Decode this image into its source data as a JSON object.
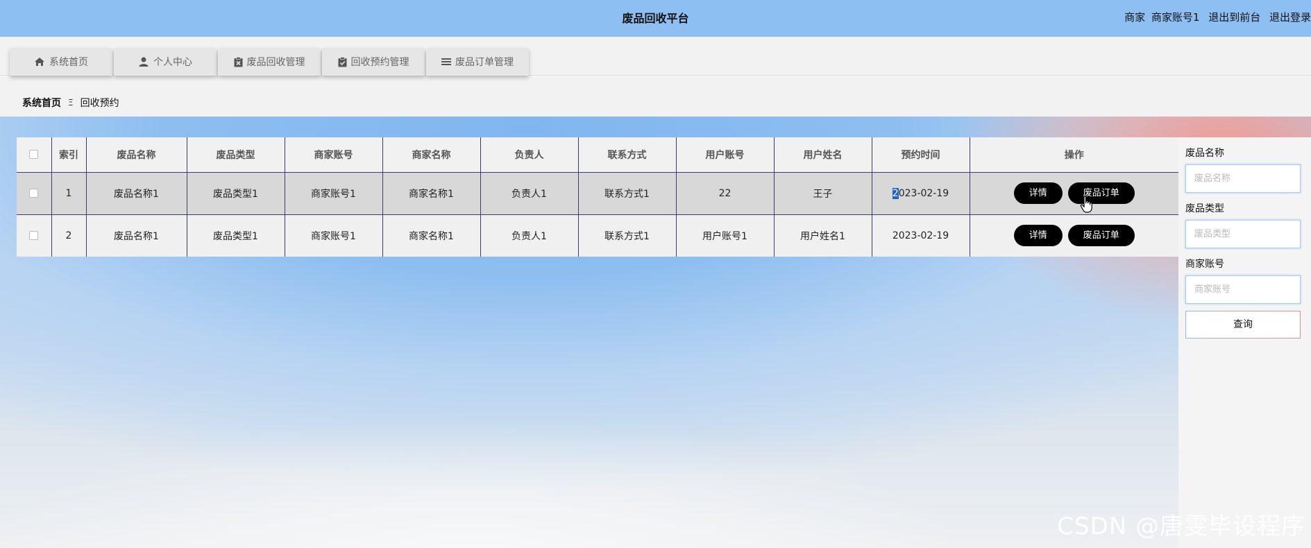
{
  "header": {
    "title": "废品回收平台",
    "user_role": "商家",
    "user_account": "商家账号1",
    "front_link": "退出到前台",
    "logout_link": "退出登录"
  },
  "nav": {
    "tabs": [
      {
        "label": "系统首页",
        "icon": "home-icon"
      },
      {
        "label": "个人中心",
        "icon": "person-icon"
      },
      {
        "label": "废品回收管理",
        "icon": "clipboard-x-icon"
      },
      {
        "label": "回收预约管理",
        "icon": "clipboard-check-icon"
      },
      {
        "label": "废品订单管理",
        "icon": "list-icon"
      }
    ]
  },
  "breadcrumb": {
    "home": "系统首页",
    "separator": "Ξ",
    "current": "回收预约"
  },
  "table": {
    "headers": [
      "索引",
      "废品名称",
      "废品类型",
      "商家账号",
      "商家名称",
      "负责人",
      "联系方式",
      "用户账号",
      "用户姓名",
      "预约时间",
      "操作"
    ],
    "rows": [
      {
        "index": "1",
        "name": "废品名称1",
        "type": "废品类型1",
        "merchant_account": "商家账号1",
        "merchant_name": "商家名称1",
        "person": "负责人1",
        "contact": "联系方式1",
        "user_account": "22",
        "user_name": "王子",
        "time_first": "2",
        "time_rest": "023-02-19"
      },
      {
        "index": "2",
        "name": "废品名称1",
        "type": "废品类型1",
        "merchant_account": "商家账号1",
        "merchant_name": "商家名称1",
        "person": "负责人1",
        "contact": "联系方式1",
        "user_account": "用户账号1",
        "user_name": "用户姓名1",
        "time": "2023-02-19"
      }
    ],
    "actions": {
      "detail": "详情",
      "order": "废品订单"
    }
  },
  "search": {
    "name_label": "废品名称",
    "name_placeholder": "废品名称",
    "type_label": "废品类型",
    "type_placeholder": "废品类型",
    "account_label": "商家账号",
    "account_placeholder": "商家账号",
    "button": "查询"
  },
  "watermark": "CSDN @唐雯毕设程序"
}
